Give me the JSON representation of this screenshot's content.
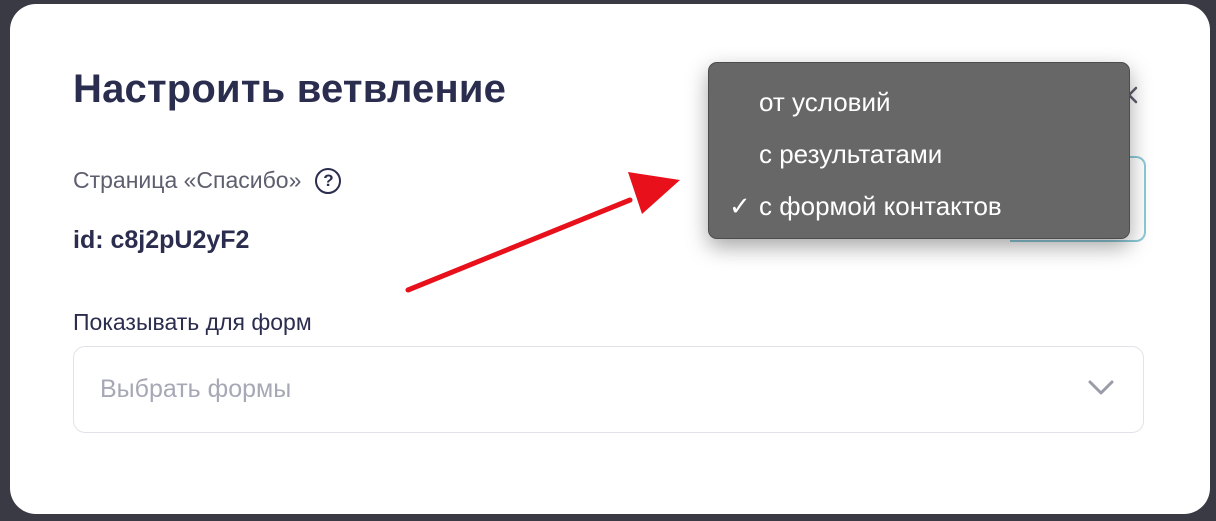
{
  "modal": {
    "title": "Настроить ветвление",
    "subpage_label": "Страница «Спасибо»",
    "help_glyph": "?",
    "page_id": "id: c8j2pU2yF2",
    "forms_label": "Показывать для форм",
    "forms_placeholder": "Выбрать формы"
  },
  "dropdown": {
    "items": [
      {
        "label": "от условий",
        "selected": false
      },
      {
        "label": "с результатами",
        "selected": false
      },
      {
        "label": "с формой контактов",
        "selected": true
      }
    ],
    "check_glyph": "✓"
  },
  "icons": {
    "close": "close-icon",
    "help": "help-icon",
    "chevron": "chevron-down-icon"
  },
  "colors": {
    "title": "#2b2d4f",
    "dropdown_bg": "#666766",
    "annotation_arrow": "#e8101a",
    "select_focus_border": "#8cc9d8"
  }
}
